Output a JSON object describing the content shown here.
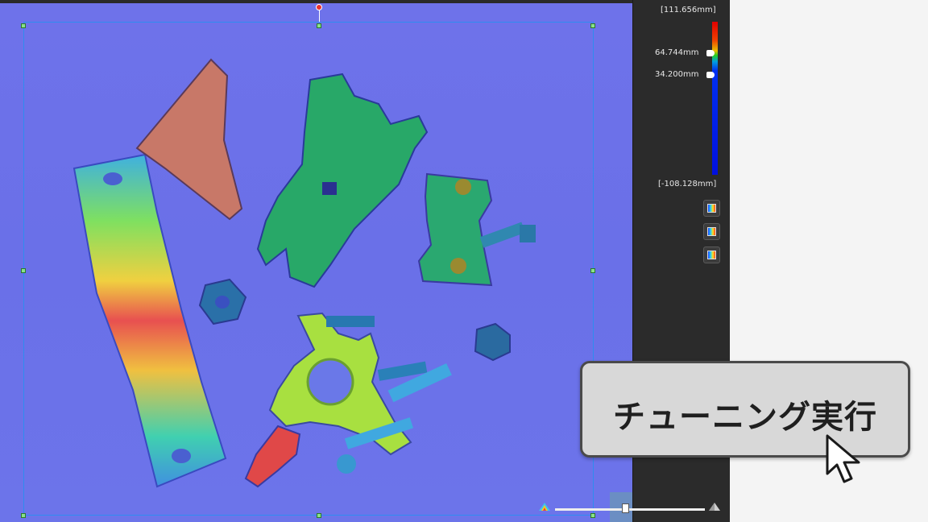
{
  "colorbar": {
    "max_label": "[111.656mm]",
    "upper_pin_label": "64.744mm",
    "lower_pin_label": "34.200mm",
    "min_label": "[-108.128mm]"
  },
  "toolbar": {
    "buttons": [
      "color-mode-icon",
      "fit-view-icon",
      "range-adjust-icon"
    ]
  },
  "viewer": {
    "slider_value": 0.47
  },
  "tune_button": {
    "label": "チューニング実行"
  }
}
